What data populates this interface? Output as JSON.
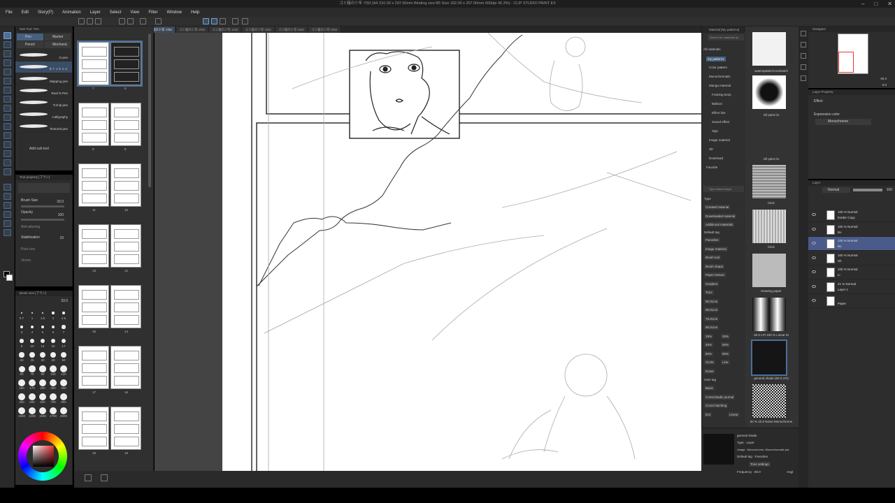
{
  "window": {
    "title": "ゴミ箱の少年 7/50 (A4 210.00 x 297.00mm Binding size:B5 Size 182.00 x 257.00mm 600dpi 40.3%) - CLIP STUDIO PAINT EX"
  },
  "menu": [
    "File",
    "Edit",
    "Story(P)",
    "Animation",
    "Layer",
    "Select",
    "View",
    "Filter",
    "Window",
    "Help"
  ],
  "doc_tabs": [
    "ゴミ箱の少年-4/50",
    "ゴミ箱の少年-5/50",
    "ゴミ箱の少年-7/50",
    "ゴミ箱の少年-2/50",
    "ゴミ箱の少年-1/50",
    "ゴミ箱の少年-3/50",
    "ゴミ箱の少年-6/50",
    "ゴミ箱の少年-8/50"
  ],
  "subtool": {
    "header": "Sub Tool: Pen",
    "tabs": [
      "Pen",
      "Marker",
      "Pencil",
      "Mechanic"
    ],
    "brushes": [
      "G-pen",
      "ｂｒｖｋｏｚ",
      "Mapping pen",
      "Real G-Pen",
      "Turnip pen",
      "Calligraphy",
      "Textured pen"
    ],
    "add_label": "Add sub tool"
  },
  "tool_property": {
    "header": "Tool property [ブラシ]",
    "brush_size_label": "Brush Size",
    "brush_size": "33.0",
    "opacity_label": "Opacity",
    "opacity": "100",
    "stabilization_label": "Stabilization",
    "stabilization": "10",
    "post_label": "Post corr.",
    "vector_label": "Vector"
  },
  "brush_size_panel": {
    "header": "Brush size [ブラシ]",
    "current": "33.0",
    "sizes": [
      "0.7",
      "1",
      "1.5",
      "2",
      "2.5",
      "3",
      "4",
      "5",
      "6",
      "7",
      "8",
      "10",
      "12",
      "15",
      "17",
      "20",
      "25",
      "30",
      "40",
      "50",
      "60",
      "70",
      "80",
      "100",
      "120",
      "150",
      "170",
      "200",
      "250",
      "300",
      "400",
      "500",
      "600",
      "700",
      "800",
      "1000",
      "1200",
      "1500",
      "1700",
      "2000"
    ]
  },
  "pages": [
    {
      "left": "7",
      "right": "6"
    },
    {
      "left": "9",
      "right": "8"
    },
    {
      "left": "11",
      "right": "10"
    },
    {
      "left": "13",
      "right": "12"
    },
    {
      "left": "15",
      "right": "14"
    },
    {
      "left": "17",
      "right": "16"
    },
    {
      "left": "19",
      "right": "18"
    }
  ],
  "material": {
    "header": "Material [My patterns]",
    "search_placeholder": "Search for materials by",
    "tree": [
      "All materials",
      "my patterns",
      "Color pattern",
      "Monochromatic",
      "Manga material",
      "Framing temp",
      "Balloon",
      "Effect line",
      "Sound effect",
      "Sign",
      "Image material",
      "3D",
      "Download",
      "Favorite"
    ],
    "tag_search_placeholder": "Type search keyw",
    "type_label": "Type",
    "type_tags": [
      "Created material",
      "Downloaded material",
      "Additional materials"
    ],
    "default_tag_label": "Default tag",
    "default_tags": [
      "Favorites",
      "Image material",
      "Brush tool",
      "Brush shape",
      "Paper texture",
      "Gradient",
      "Tone",
      "60.0Line",
      "65.0Line",
      "75.0Line",
      "85.0Line",
      "15%",
      "25%",
      "40%",
      "50%",
      "60%",
      "80%",
      "Circle",
      "Line",
      "Noise"
    ],
    "user_tag_label": "User tag",
    "user_tags": [
      "Basic",
      "ComicStudio journal",
      "Cross-hatching",
      "Dot",
      "Linear"
    ],
    "thumbs": [
      "waterspatter/crosshatch",
      "Oil paint 01",
      "Oil paint 01",
      "brick",
      "brick",
      "Drawing paper",
      "60.0 LPI 100 % Linear M",
      "general shade (60.0 LPI)",
      "60 % 40.0 Noise Monochrome"
    ],
    "detail": {
      "name": "general shade",
      "type": "Type : Layer",
      "usage": "Usage : Monochrome, Monochromatic pat",
      "default_tag": "Default tag : Favorites",
      "tone_settings": "Tone settings",
      "frequency": "Frequency : 60.0",
      "angle": "Angl"
    }
  },
  "navigator": {
    "header": "Navigator",
    "zoom": "40.3",
    "angle": "0.0"
  },
  "layer_property": {
    "header": "Layer Property",
    "effect_label": "Effect",
    "expression_label": "Expression color",
    "expression_value": "Monochrome"
  },
  "layers_panel": {
    "header": "Layer",
    "blend": "Normal",
    "opacity": "100"
  },
  "layers": [
    {
      "mode": "100 % Normal",
      "name": "border Copy"
    },
    {
      "mode": "100 % Normal",
      "name": "Bo"
    },
    {
      "mode": "100 % Normal",
      "name": "Bo"
    },
    {
      "mode": "100 % Normal",
      "name": "Sh"
    },
    {
      "mode": "100 % Normal",
      "name": "Li"
    },
    {
      "mode": "41 % Normal",
      "name": "Layer 1"
    },
    {
      "mode": "",
      "name": "Paper"
    }
  ],
  "colors": {
    "accent": "#4a6f9c",
    "panel": "#2d2d2d"
  }
}
